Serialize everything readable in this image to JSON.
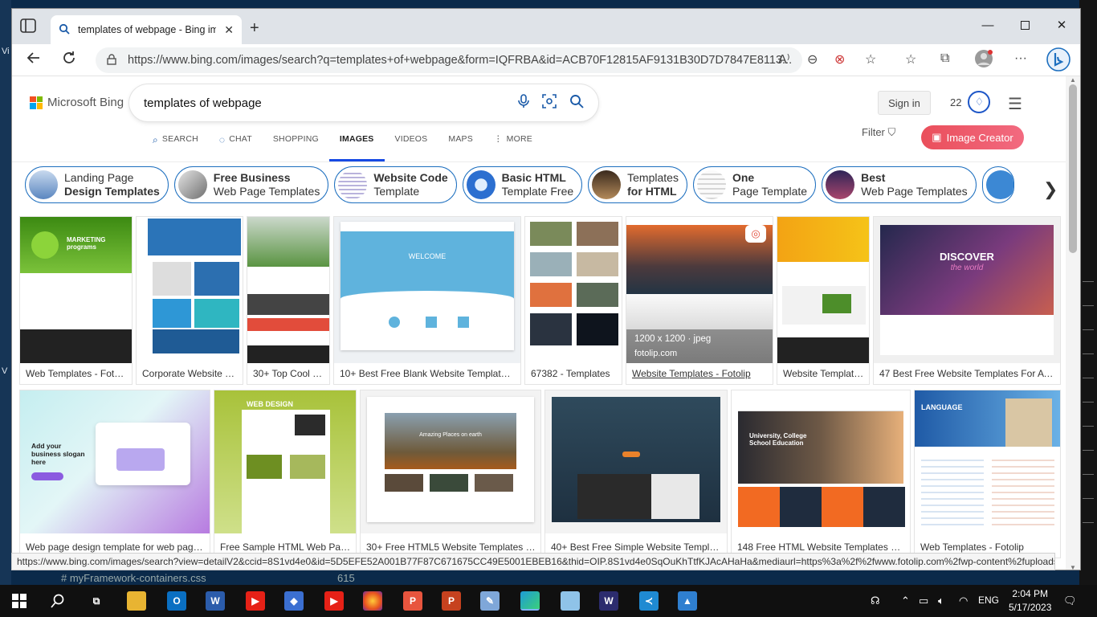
{
  "browser": {
    "tab_title": "templates of webpage - Bing images",
    "new_tab": "+",
    "url": "https://www.bing.com/images/search?q=templates+of+webpage&form=IQFRBA&id=ACB70F12815AF9131B30D7D7847E8113...",
    "status_url": "https://www.bing.com/images/search?view=detailV2&ccid=8S1vd4e0&id=5D5EFE52A001B77F87C671675CC49E5001EBEB16&thid=OIP.8S1vd4e0SqOuKhTtfKJAcAHaHa&mediaurl=https%3a%2f%2fwww.fotolip.com%2fwp-content%2fuploads..."
  },
  "bing": {
    "logo_text": "Microsoft Bing",
    "query": "templates of webpage",
    "sign_in": "Sign in",
    "rewards_count": "22",
    "filter": "Filter",
    "image_creator": "Image Creator",
    "nav": [
      {
        "label": "SEARCH",
        "icon": "search-icon"
      },
      {
        "label": "CHAT",
        "icon": "chat-icon"
      },
      {
        "label": "SHOPPING",
        "icon": ""
      },
      {
        "label": "IMAGES",
        "icon": ""
      },
      {
        "label": "VIDEOS",
        "icon": ""
      },
      {
        "label": "MAPS",
        "icon": ""
      },
      {
        "label": "MORE",
        "icon": "more-vertical-icon"
      }
    ]
  },
  "related": [
    {
      "line1": "Landing Page",
      "line2": "Design Templates",
      "bold": 2
    },
    {
      "line1": "Free Business",
      "line2": "Web Page Templates",
      "bold": 1
    },
    {
      "line1": "Website Code",
      "line2": "Template",
      "bold": 1
    },
    {
      "line1": "Basic HTML",
      "line2": "Template Free",
      "bold": 1
    },
    {
      "line1": "Templates",
      "line2": "for HTML",
      "bold": 2
    },
    {
      "line1": "One",
      "line2": "Page Template",
      "bold": 1
    },
    {
      "line1": "Best",
      "line2": "Web Page Templates",
      "bold": 1
    }
  ],
  "results_row1": [
    {
      "caption": "Web Templates - Fotolip"
    },
    {
      "caption": "Corporate Website Te..."
    },
    {
      "caption": "30+ Top Cool Sh..."
    },
    {
      "caption": "10+ Best Free Blank Website Templates For ..."
    },
    {
      "caption": "67382 - Templates"
    },
    {
      "caption": "Website Templates - Fotolip",
      "size": "1200 x 1200 · jpeg",
      "source": "fotolip.com"
    },
    {
      "caption": "Website Templates..."
    },
    {
      "caption": "47 Best Free Website Templates For A Tren..."
    }
  ],
  "results_row2": [
    {
      "caption": "Web page design template for web page des..."
    },
    {
      "caption": "Free Sample HTML Web Page T..."
    },
    {
      "caption": "30+ Free HTML5 Website Templates For A..."
    },
    {
      "caption": "40+ Best Free Simple Website Templates ..."
    },
    {
      "caption": "148 Free HTML Website Templates 2020 - ..."
    },
    {
      "caption": "Web Templates - Fotolip"
    }
  ],
  "thumb_text": {
    "welcome": "WELCOME",
    "discover": "DISCOVER",
    "the_world": "the world",
    "marketing": "MARKETING programs",
    "university": "University, College School Education",
    "language": "LANGUAGE",
    "amazing": "Amazing Places on earth",
    "slogan": "Add your business slogan here",
    "web_design": "WEB DESIGN"
  },
  "background": {
    "editor_file": "# myFramework-containers.css",
    "line_no": "615"
  },
  "taskbar": {
    "language": "ENG",
    "time": "2:04 PM",
    "date": "5/17/2023"
  },
  "desktop_left_letters": [
    "Vi",
    "V"
  ]
}
